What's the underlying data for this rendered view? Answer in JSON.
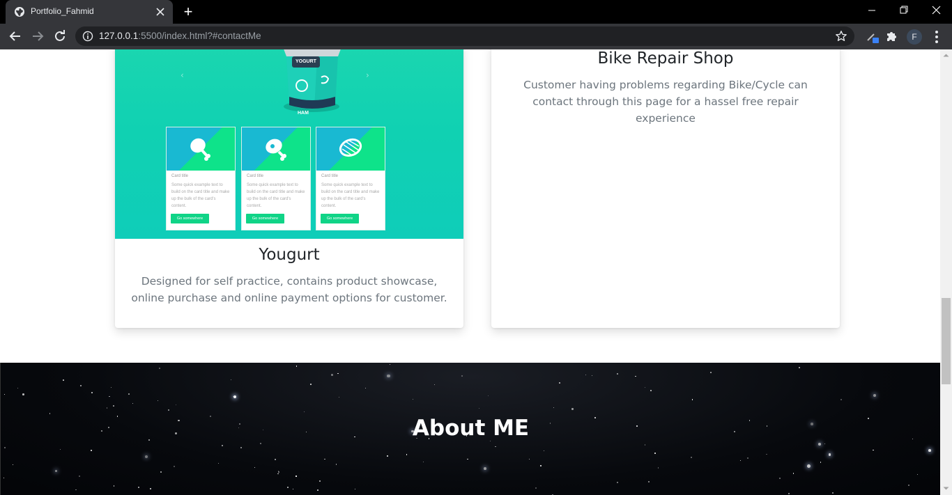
{
  "browser": {
    "tab_title": "Portfolio_Fahmid",
    "new_tab_symbol": "+",
    "url_host": "127.0.0.1",
    "url_rest": ":5500/index.html?#contactMe",
    "profile_initial": "F"
  },
  "projects": [
    {
      "title": "Yougurt",
      "description": "Designed for self practice, contains product showcase, online purchase and online payment options for customer.",
      "preview": {
        "product_label": "YOGURT",
        "product_sub": "HAM",
        "cards": [
          {
            "title": "Card title",
            "text": "Some quick example text to build on the card title and make up the bulk of the card's content.",
            "button": "Go somewhere"
          },
          {
            "title": "Card title",
            "text": "Some quick example text to build on the card title and make up the bulk of the card's content.",
            "button": "Go somewhere"
          },
          {
            "title": "Card title",
            "text": "Some quick example text to build on the card title and make up the bulk of the card's content.",
            "button": "Go somewhere"
          }
        ]
      }
    },
    {
      "title": "Bike Repair Shop",
      "description": "Customer having problems regarding Bike/Cycle can contact through this page for a hassel free repair experience"
    }
  ],
  "about": {
    "title": "About ME"
  },
  "icons": {
    "tab_favicon": "globe-icon",
    "back": "back-arrow-icon",
    "forward": "forward-arrow-icon",
    "reload": "reload-icon",
    "site_info": "info-icon",
    "bookmark": "star-icon",
    "extension": "puzzle-icon",
    "menu": "more-vertical-icon"
  }
}
